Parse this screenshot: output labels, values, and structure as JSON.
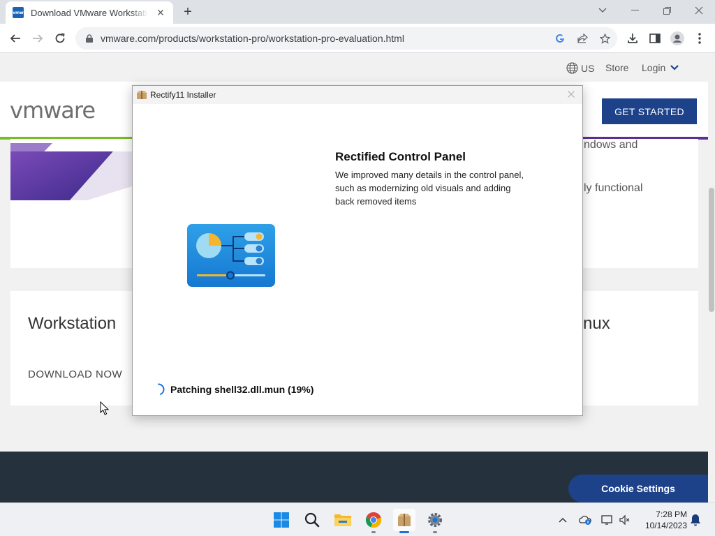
{
  "browser": {
    "tab_title": "Download VMware Workstation Pro",
    "favicon_text": "vmw",
    "url": "vmware.com/products/workstation-pro/workstation-pro-evaluation.html"
  },
  "site": {
    "locale": "US",
    "store": "Store",
    "login": "Login",
    "logo": "vmware",
    "get_started": "GET STARTED",
    "hero_text_1": "ndows and",
    "hero_text_2": "ly functional",
    "ws_title": "Workstation",
    "ws_title_right": "nux",
    "download_now": "DOWNLOAD NOW",
    "cookie_settings": "Cookie Settings"
  },
  "dialog": {
    "title": "Rectify11 Installer",
    "feature_title": "Rectified Control Panel",
    "feature_desc": "We improved many details in the control panel, such as modernizing old visuals and adding back removed items",
    "status": "Patching shell32.dll.mun (19%)"
  },
  "taskbar": {
    "time": "7:28 PM",
    "date": "10/14/2023"
  },
  "colors": {
    "vmware_blue": "#1d428a",
    "green_accent": "#78be20",
    "purple_accent": "#5b2f91",
    "footer_dark": "#25313c"
  }
}
